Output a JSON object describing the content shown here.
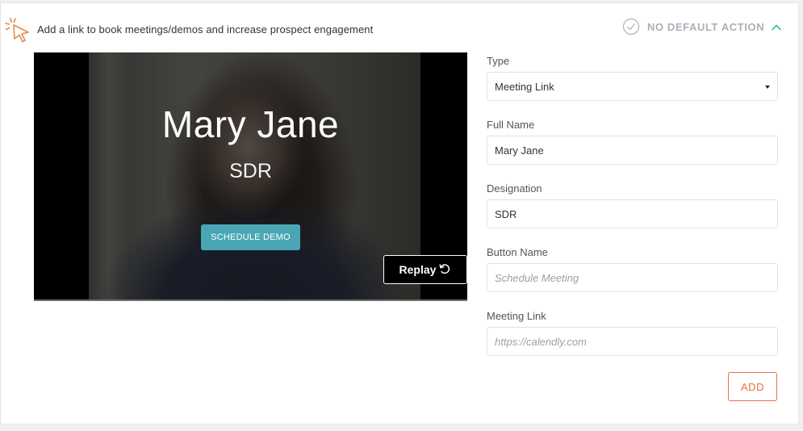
{
  "header": {
    "icon": "pointer-click-icon",
    "text": "Add a link to book meetings/demos and increase prospect engagement",
    "status_icon": "check-circle-icon",
    "status_text": "NO DEFAULT ACTION",
    "collapse_icon": "chevron-up-icon",
    "accent_color": "#e38a4a",
    "collapse_color": "#3fb89c"
  },
  "preview": {
    "name": "Mary Jane",
    "title": "SDR",
    "cta_label": "SCHEDULE DEMO",
    "replay_label": "Replay",
    "replay_icon": "replay-icon",
    "cta_color": "#4aa6b4"
  },
  "form": {
    "type_label": "Type",
    "type_value": "Meeting Link",
    "full_name_label": "Full Name",
    "full_name_value": "Mary Jane",
    "designation_label": "Designation",
    "designation_value": "SDR",
    "button_name_label": "Button Name",
    "button_name_placeholder": "Schedule Meeting",
    "meeting_link_label": "Meeting Link",
    "meeting_link_placeholder": "https://calendly.com",
    "add_label": "ADD",
    "add_color": "#e3714a"
  }
}
